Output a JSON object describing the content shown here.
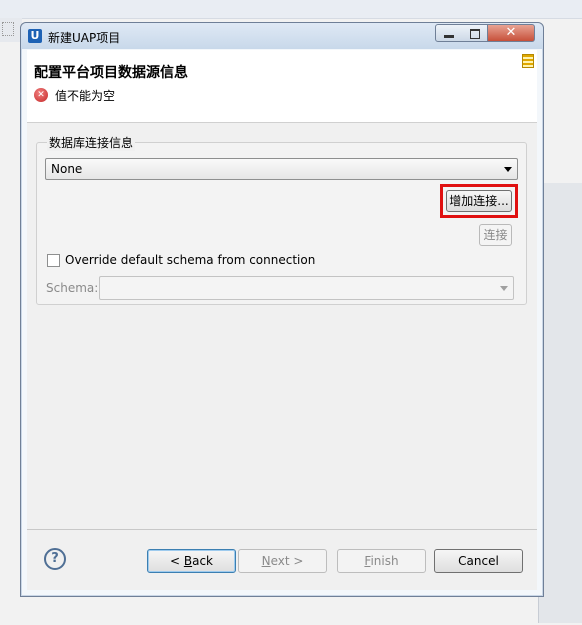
{
  "window": {
    "title": "新建UAP项目",
    "icon_letter": "U"
  },
  "header": {
    "title": "配置平台项目数据源信息",
    "error_message": "值不能为空"
  },
  "group": {
    "label": "数据库连接信息",
    "connection_value": "None",
    "add_connection_label": "增加连接...",
    "connect_label": "连接",
    "override_label": "Override default schema from connection",
    "override_checked": false,
    "schema_label": "Schema:",
    "schema_value": ""
  },
  "footer": {
    "back_pre": "< ",
    "back_key": "B",
    "back_rest": "ack",
    "next_key": "N",
    "next_rest": "ext >",
    "finish_key": "F",
    "finish_rest": "inish",
    "cancel_label": "Cancel"
  },
  "colors": {
    "highlight": "#e01010",
    "error": "#c62828"
  }
}
